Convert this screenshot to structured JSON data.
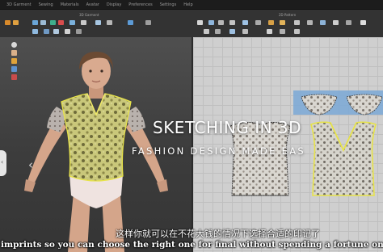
{
  "app": {
    "menu": [
      "3D Garment",
      "Sewing",
      "Materials",
      "Avatar",
      "Display",
      "Preferences",
      "Settings",
      "Help"
    ]
  },
  "toolbar": {
    "left_label": "3D Garment",
    "right_label": "2D Pattern"
  },
  "overlay": {
    "title": "SKETCHING IN 3D",
    "subtitle": "FASHION DESIGN MADE EAS"
  },
  "subtitles": {
    "cn": "这样你就可以在不花大钱的情况下选择合适的印记了",
    "en": "imprints so you can choose the right one for final without spending a fortune on"
  },
  "colors": {
    "garment_fill": "#c9c77a",
    "garment_outline": "#e7e34a",
    "selection_blue": "#7aa8d6",
    "grid_bg": "#cfcfcf"
  },
  "icons": {
    "prev": "chevron-left-icon",
    "handle": "chevron-left-icon"
  }
}
